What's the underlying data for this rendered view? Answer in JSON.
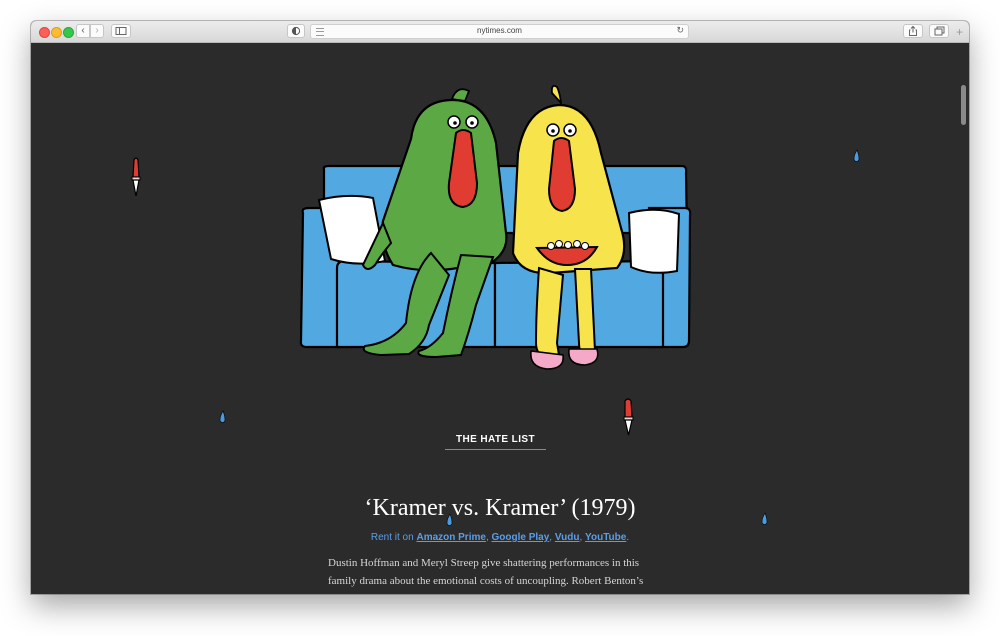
{
  "browser": {
    "url": "nytimes.com",
    "back_glyph": "‹",
    "forward_glyph": "›",
    "reload_glyph": "↻",
    "new_tab_glyph": "+"
  },
  "article": {
    "section_label": "THE HATE LIST",
    "headline": "‘Kramer vs. Kramer’",
    "year": "(1979)",
    "rent_prefix": "Rent it on",
    "rent_links": [
      "Amazon Prime",
      "Google Play",
      "Vudu",
      "YouTube"
    ],
    "rent_sep": ", ",
    "rent_suffix": ".",
    "body": "Dustin Hoffman and Meryl Streep give shattering performances in this family drama about the emotional costs of uncoupling. Robert Benton’s Oscar-winning film is great hate-watching for children of divorce, especially Gen X kids, who grew up learning the hard way."
  },
  "colors": {
    "page_bg": "#2b2b2b",
    "sofa_blue": "#52a8e0",
    "green_creature": "#5ca845",
    "yellow_creature": "#f7e34c",
    "nose_red": "#e03c31",
    "link_blue": "#5b9ee6"
  },
  "icons": [
    "back-icon",
    "forward-icon",
    "sidebar-icon",
    "shield-icon",
    "reader-icon",
    "reload-icon",
    "share-icon",
    "tabs-icon",
    "new-tab-icon",
    "knife-icon",
    "water-drop-icon"
  ]
}
